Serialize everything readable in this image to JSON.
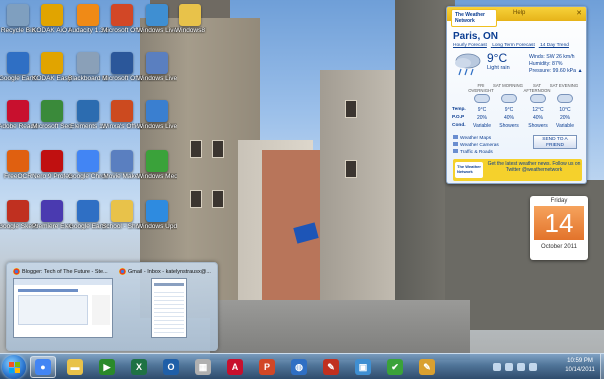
{
  "desktop": {
    "icons": [
      {
        "label": "Recycle Bin",
        "icon": "recycle-bin-icon",
        "color": "#7f9fbf"
      },
      {
        "label": "KODAK AiO Home Center",
        "icon": "kodak-icon",
        "color": "#e1a400"
      },
      {
        "label": "Audacity 1.3 Beta (Unicode)",
        "icon": "audacity-icon",
        "color": "#f08a16"
      },
      {
        "label": "Microsoft Office Po...",
        "icon": "powerpoint-icon",
        "color": "#d24726"
      },
      {
        "label": "Windows Live Mess...",
        "icon": "messenger-icon",
        "color": "#3f8fd2"
      },
      {
        "label": "Windows8",
        "icon": "folder-icon",
        "color": "#e8c24a"
      },
      {
        "label": "Google Earth",
        "icon": "google-earth-icon",
        "color": "#2f6fc4"
      },
      {
        "label": "KODAK EasyShare...",
        "icon": "kodak-icon",
        "color": "#e1a400"
      },
      {
        "label": "Blackboard Clickers...",
        "icon": "document-icon",
        "color": "#8aa0b8"
      },
      {
        "label": "Microsoft Office Wo...",
        "icon": "word-icon",
        "color": "#2b579a"
      },
      {
        "label": "Windows Live Movie...",
        "icon": "movie-maker-icon",
        "color": "#5a7fc0"
      },
      {
        "label": "Adobe Reader X",
        "icon": "adobe-reader-icon",
        "color": "#c8102e"
      },
      {
        "label": "Microsoft Security...",
        "icon": "security-icon",
        "color": "#3a8a3a"
      },
      {
        "label": "Elements 11",
        "icon": "elements-icon",
        "color": "#2c6cb0"
      },
      {
        "label": "Winxa's Office",
        "icon": "office-icon",
        "color": "#cc4a1f"
      },
      {
        "label": "Windows Live Photo...",
        "icon": "photo-gallery-icon",
        "color": "#3a7fd0"
      },
      {
        "label": "FreeOCR",
        "icon": "freeocr-icon",
        "color": "#e06010"
      },
      {
        "label": "Nero 9 Professional",
        "icon": "nero-icon",
        "color": "#c01010"
      },
      {
        "label": "Google Chrome",
        "icon": "chrome-icon",
        "color": "#4285f4"
      },
      {
        "label": "Movie Maker",
        "icon": "movie-maker-icon",
        "color": "#5a7fc0"
      },
      {
        "label": "Windows Media Center",
        "icon": "media-center-icon",
        "color": "#3aa23a"
      },
      {
        "label": "Google SketchUp 8",
        "icon": "sketchup-icon",
        "color": "#c03020"
      },
      {
        "label": "Premiere Elements...",
        "icon": "premiere-icon",
        "color": "#4a3ab0"
      },
      {
        "label": "Google Earth",
        "icon": "google-earth-icon",
        "color": "#2f6fc4"
      },
      {
        "label": "School - Shortcut",
        "icon": "folder-icon",
        "color": "#e8c24a"
      },
      {
        "label": "Windows Update",
        "icon": "windows-update-icon",
        "color": "#2e8be0"
      }
    ]
  },
  "weather": {
    "brand": "The Weather Network",
    "help": "Help",
    "city": "Paris, ON",
    "links": [
      "Hourly Forecast",
      "Long Term Forecast",
      "14 Day Trend"
    ],
    "temp": "9°C",
    "condition": "Light rain",
    "details": [
      "Winds: SW 26 km/h",
      "Humidity: 87%",
      "Pressure: 99.60 kPa ▲"
    ],
    "periods": [
      "FRI OVERNIGHT",
      "SAT MORNING",
      "SAT AFTERNOON",
      "SAT EVENING"
    ],
    "rows": {
      "temp_label": "Temp.",
      "pop_label": "P.O.P",
      "cond_label": "Cond.",
      "temps": [
        "9°C",
        "9°C",
        "12°C",
        "10°C"
      ],
      "pops": [
        "20%",
        "40%",
        "40%",
        "20%"
      ],
      "conds": [
        "Variable",
        "Showers",
        "Showers",
        "Variable"
      ]
    },
    "bottom_links": [
      "Weather Maps",
      "Weather Cameras",
      "Traffic & Roads"
    ],
    "send_button": "SEND TO A FRIEND",
    "ad_text": "Get the latest weather news. Follow us on Twitter @weathernetwork",
    "accent": "#f5d12c"
  },
  "calendar": {
    "weekday": "Friday",
    "day": "14",
    "month_year": "October 2011"
  },
  "thumbnails": [
    {
      "title": "Blogger: Tech of The Future - Ste..."
    },
    {
      "title": "Gmail - Inbox - katelynstrausx@..."
    }
  ],
  "taskbar": {
    "buttons": [
      {
        "name": "chrome",
        "icon": "chrome-icon",
        "color": "#4285f4",
        "active": true
      },
      {
        "name": "explorer",
        "icon": "folder-icon",
        "color": "#e8c24a",
        "active": false
      },
      {
        "name": "media-player",
        "icon": "media-player-icon",
        "color": "#2a8a2a",
        "active": false
      },
      {
        "name": "excel",
        "icon": "excel-icon",
        "color": "#1f7244",
        "active": false
      },
      {
        "name": "outlook",
        "icon": "outlook-icon",
        "color": "#1f5fa8",
        "active": false
      },
      {
        "name": "paint",
        "icon": "paint-icon",
        "color": "#b0b0b0",
        "active": false
      },
      {
        "name": "adobe-reader",
        "icon": "adobe-reader-icon",
        "color": "#c8102e",
        "active": false
      },
      {
        "name": "powerpoint",
        "icon": "powerpoint-icon",
        "color": "#d24726",
        "active": false
      },
      {
        "name": "google-earth",
        "icon": "google-earth-icon",
        "color": "#2f6fc4",
        "active": false
      },
      {
        "name": "sketchup",
        "icon": "sketchup-icon",
        "color": "#c03020",
        "active": false
      },
      {
        "name": "remote-desktop",
        "icon": "remote-desktop-icon",
        "color": "#3f8fd2",
        "active": false
      },
      {
        "name": "checkmark",
        "icon": "checkmark-icon",
        "color": "#3aa23a",
        "active": false
      },
      {
        "name": "notepad",
        "icon": "pencil-icon",
        "color": "#d9a030",
        "active": false
      }
    ],
    "clock_time": "10:59 PM",
    "clock_date": "10/14/2011"
  }
}
